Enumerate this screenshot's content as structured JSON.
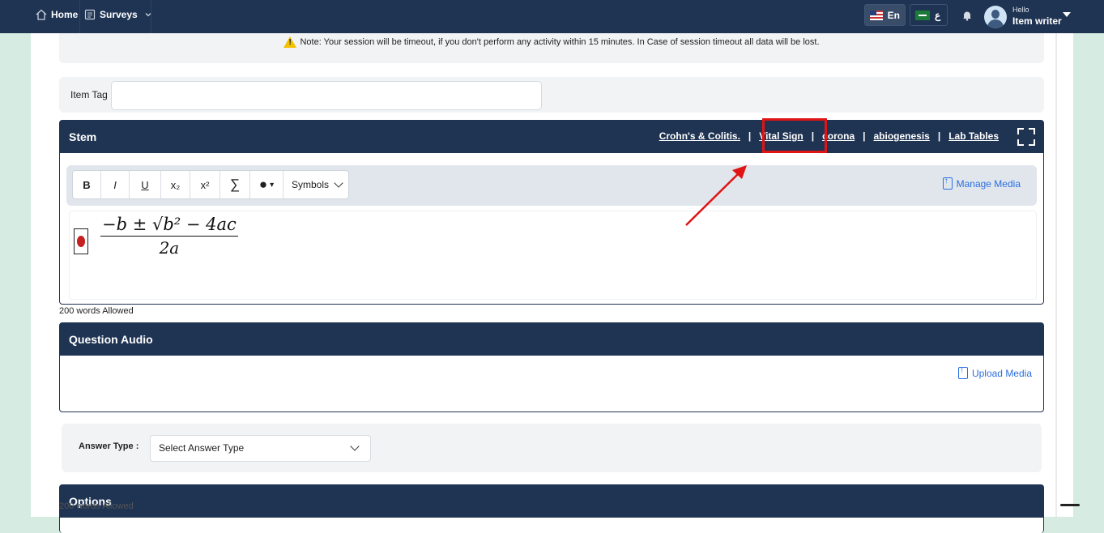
{
  "nav": {
    "home": "Home",
    "surveys": "Surveys",
    "lang_en": "En",
    "lang_ar": "ع",
    "hello": "Hello",
    "user": "Item writer"
  },
  "note": "Note: Your session will be timeout, if you don't perform any activity within 15 minutes. In Case of session timeout all data will be lost.",
  "item_tag": {
    "label": "Item Tag",
    "value": ""
  },
  "stem": {
    "title": "Stem",
    "links": [
      "Crohn's & Colitis.",
      "Vital Sign",
      "corona",
      "abiogenesis",
      "Lab Tables"
    ],
    "toolbar": {
      "bold": "B",
      "italic": "I",
      "underline": "U",
      "subscript": "x₂",
      "superscript": "x²",
      "sigma": "∑",
      "color": "●",
      "color_caret": "▾",
      "symbols": "Symbols"
    },
    "manage_media": "Manage Media",
    "formula_numerator": "−b ± √b² − 4ac",
    "formula_denominator": "2a"
  },
  "words_allowed": "200 words Allowed",
  "question_audio": {
    "title": "Question Audio",
    "upload": "Upload Media"
  },
  "answer_type": {
    "label": "Answer Type :",
    "placeholder": "Select Answer Type"
  },
  "options": {
    "title": "Options"
  },
  "colors": {
    "navy": "#1f3352",
    "accent_blue": "#2a6ee0",
    "highlight_red": "#e01414"
  }
}
